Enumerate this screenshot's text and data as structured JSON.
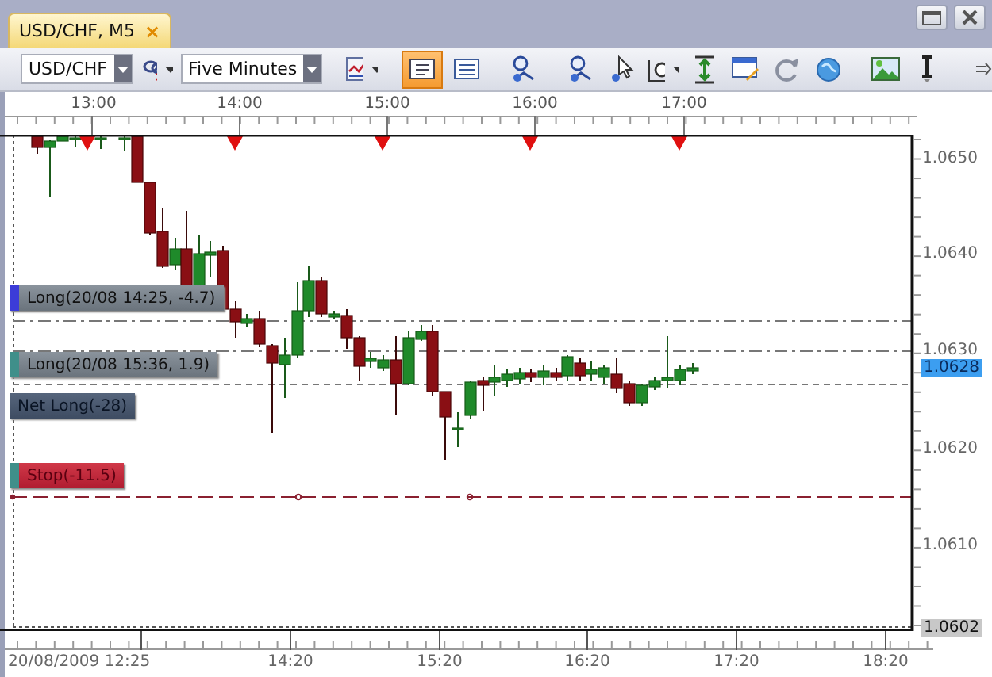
{
  "tab": {
    "title": "USD/CHF, M5",
    "close": "×"
  },
  "toolbar": {
    "symbol": "USD/CHF",
    "timeframe": "Five Minutes",
    "tools": [
      {
        "kind": "remove",
        "selected": false,
        "menu": true
      },
      {
        "kind": "wave",
        "selected": false,
        "menu": true
      },
      {
        "kind": "panel",
        "selected": true,
        "menu": false
      },
      {
        "kind": "list",
        "selected": false,
        "menu": false
      },
      {
        "kind": "pointer",
        "selected": false,
        "menu": false
      },
      {
        "kind": "pointer",
        "selected": false,
        "menu": false
      },
      {
        "kind": "cursor",
        "selected": false,
        "menu": false
      },
      {
        "kind": "zoom",
        "selected": false,
        "menu": true
      },
      {
        "kind": "fit",
        "selected": false,
        "menu": false
      },
      {
        "kind": "note",
        "selected": false,
        "menu": false
      },
      {
        "kind": "refresh",
        "selected": false,
        "menu": false
      },
      {
        "kind": "globe",
        "selected": false,
        "menu": false
      },
      {
        "kind": "picture",
        "selected": false,
        "menu": false
      },
      {
        "kind": "text",
        "selected": false,
        "menu": false
      },
      {
        "kind": "more",
        "selected": false,
        "menu": false
      }
    ]
  },
  "chart": {
    "top_times": [
      "13:00",
      "14:00",
      "15:00",
      "16:00",
      "17:00"
    ],
    "prices": [
      "1.0650",
      "1.0640",
      "1.0630",
      "1.0620",
      "1.0610"
    ],
    "current_price": "1.0628",
    "low_price": "1.0602",
    "bottom_times": [
      "20/08/2009 12:25",
      "14:20",
      "15:20",
      "16:20",
      "17:20",
      "18:20"
    ],
    "positions": [
      {
        "kind": "long",
        "text": "Long(20/08 14:25, -4.7)",
        "color": "#3c3cd8"
      },
      {
        "kind": "long",
        "text": "Long(20/08 15:36, 1.9)",
        "color": "#3f8f8a"
      },
      {
        "kind": "net",
        "text": "Net Long(-28)"
      },
      {
        "kind": "stop",
        "text": "Stop(-11.5)",
        "color": "#3f8f8a"
      }
    ]
  }
}
